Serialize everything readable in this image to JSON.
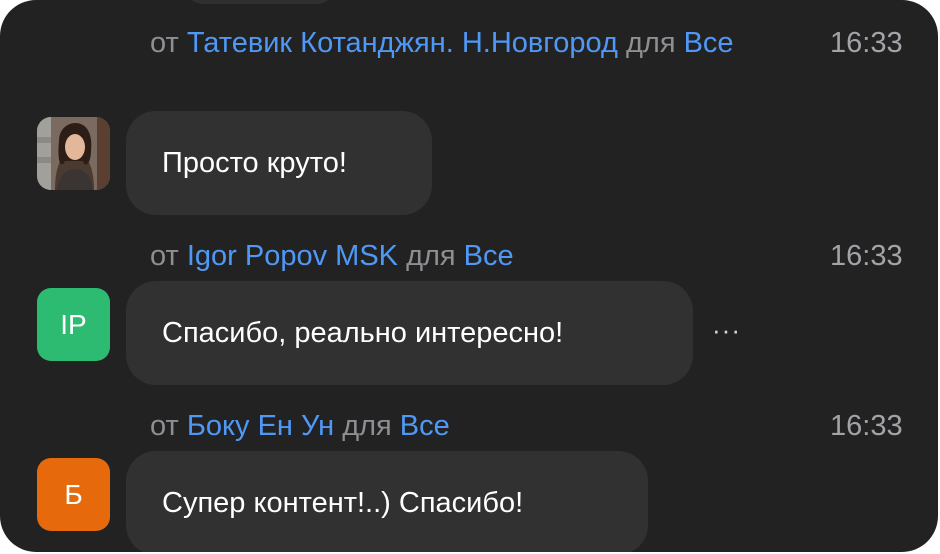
{
  "colors": {
    "background": "#222223",
    "bubble": "#313132",
    "name_link": "#4f98f6",
    "meta_text": "#8e8e93",
    "avatar_ip": "#2dbb72",
    "avatar_b": "#e66a0c"
  },
  "messages": [
    {
      "from_label": "от",
      "sender": "Татевик Котанджян. Н.Новгород",
      "to_label": "для",
      "recipient": "Все",
      "time": "16:33",
      "avatar": {
        "type": "photo",
        "icon": "user-photo-avatar"
      },
      "text": "Просто круто!"
    },
    {
      "from_label": "от",
      "sender": "Igor Popov MSK",
      "to_label": "для",
      "recipient": "Все",
      "time": "16:33",
      "avatar": {
        "type": "initials",
        "initials": "IP"
      },
      "text": "Спасибо, реально интересно!",
      "more_icon": "ellipsis-icon",
      "more_label": "···"
    },
    {
      "from_label": "от",
      "sender": "Боку Ен Ун",
      "to_label": "для",
      "recipient": "Все",
      "time": "16:33",
      "avatar": {
        "type": "initials",
        "initials": "Б"
      },
      "text": "Супер контент!..) Спасибо!"
    }
  ]
}
